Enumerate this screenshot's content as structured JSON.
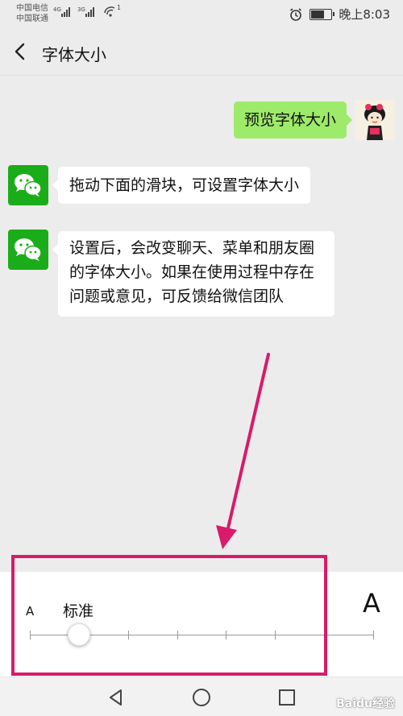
{
  "status_bar": {
    "carrier_1": "中国电信",
    "carrier_2": "中国联通",
    "sig1_type": "4G",
    "sig2_type": "3G",
    "wifi_badge": "1",
    "time": "晚上8:03",
    "battery_level": 0.6
  },
  "header": {
    "title": "字体大小"
  },
  "chat": {
    "preview_message": "预览字体大小",
    "message_1": "拖动下面的滑块，可设置字体大小",
    "message_2": "设置后，会改变聊天、菜单和朋友圈的字体大小。如果在使用过程中存在问题或意见，可反馈给微信团队"
  },
  "font_panel": {
    "small_label": "A",
    "large_label": "A",
    "current_label": "标准",
    "steps": 8,
    "selected_step": 1
  },
  "nav_bar": {
    "watermark": "Baidu经验"
  },
  "colors": {
    "accent_green": "#9eea6a",
    "wechat_green": "#1aad19",
    "annotation": "#d81b6a"
  }
}
